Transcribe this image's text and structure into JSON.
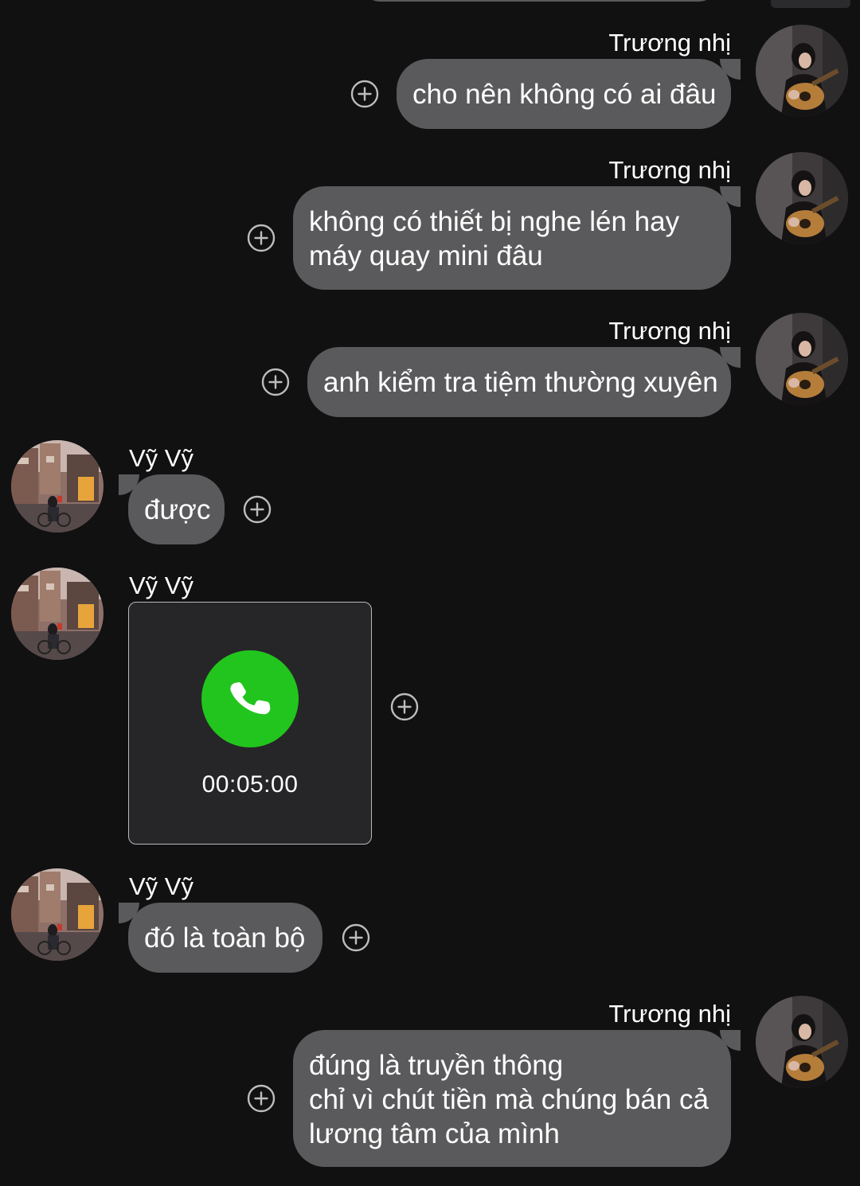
{
  "colors": {
    "background": "#111112",
    "bubble": "#5a5a5c",
    "call_green": "#22c51d",
    "card": "#262628"
  },
  "messages": [
    {
      "sender": "Trương nhị",
      "side": "right",
      "lines": [
        "cho nên không có ai đâu"
      ]
    },
    {
      "sender": "Trương nhị",
      "side": "right",
      "lines": [
        "không có thiết bị nghe lén hay",
        "máy quay mini đâu"
      ]
    },
    {
      "sender": "Trương nhị",
      "side": "right",
      "lines": [
        "anh kiểm tra tiệm thường xuyên"
      ]
    },
    {
      "sender": "Vỹ Vỹ",
      "side": "left",
      "lines": [
        "được"
      ]
    },
    {
      "sender": "Vỹ Vỹ",
      "side": "left",
      "type": "call",
      "call_duration": "00:05:00",
      "icon": "phone-icon"
    },
    {
      "sender": "Vỹ Vỹ",
      "side": "left",
      "lines": [
        "đó là toàn bộ"
      ]
    },
    {
      "sender": "Trương nhị",
      "side": "right",
      "lines": [
        "đúng là truyền thông",
        "chỉ vì chút tiền mà chúng bán cả",
        "lương tâm của mình"
      ]
    }
  ],
  "icons": {
    "reaction": "plus-circle-icon",
    "avatar_right": "avatar-guitarist",
    "avatar_left": "avatar-street-bicycle"
  }
}
